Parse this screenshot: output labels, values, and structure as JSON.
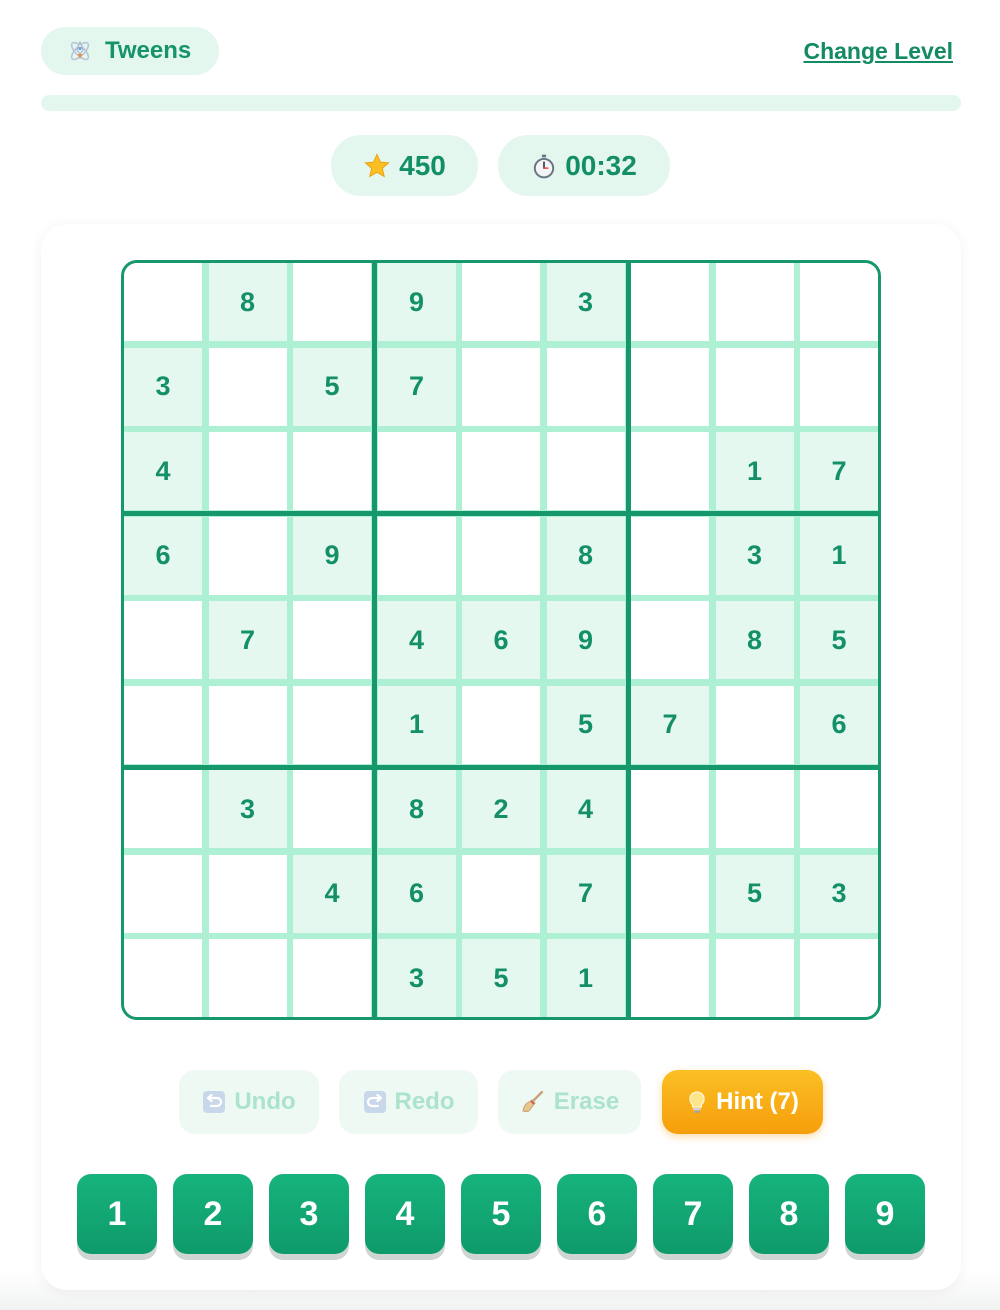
{
  "header": {
    "level_label": "Tweens",
    "level_icon": "rocket-icon",
    "change_level_label": "Change Level"
  },
  "progress": {
    "fraction": 0.0
  },
  "stats": {
    "score_icon": "star-icon",
    "score": "450",
    "timer_icon": "stopwatch-icon",
    "timer": "00:32"
  },
  "board": {
    "rows": [
      [
        "",
        "8",
        "",
        "9",
        "",
        "3",
        "",
        "",
        ""
      ],
      [
        "3",
        "",
        "5",
        "7",
        "",
        "",
        "",
        "",
        ""
      ],
      [
        "4",
        "",
        "",
        "",
        "",
        "",
        "",
        "1",
        "7"
      ],
      [
        "6",
        "",
        "9",
        "",
        "",
        "8",
        "",
        "3",
        "1"
      ],
      [
        "",
        "7",
        "",
        "4",
        "6",
        "9",
        "",
        "8",
        "5"
      ],
      [
        "",
        "",
        "",
        "1",
        "",
        "5",
        "7",
        "",
        "6"
      ],
      [
        "",
        "3",
        "",
        "8",
        "2",
        "4",
        "",
        "",
        ""
      ],
      [
        "",
        "",
        "4",
        "6",
        "",
        "7",
        "",
        "5",
        "3"
      ],
      [
        "",
        "",
        "",
        "3",
        "5",
        "1",
        "",
        "",
        ""
      ]
    ]
  },
  "toolbar": {
    "undo_label": "Undo",
    "redo_label": "Redo",
    "erase_label": "Erase",
    "hint_label": "Hint (7)"
  },
  "numpad": [
    "1",
    "2",
    "3",
    "4",
    "5",
    "6",
    "7",
    "8",
    "9"
  ],
  "colors": {
    "primary": "#16986c",
    "given_cell": "#e5f8ef",
    "hint": "#f59e0b"
  }
}
